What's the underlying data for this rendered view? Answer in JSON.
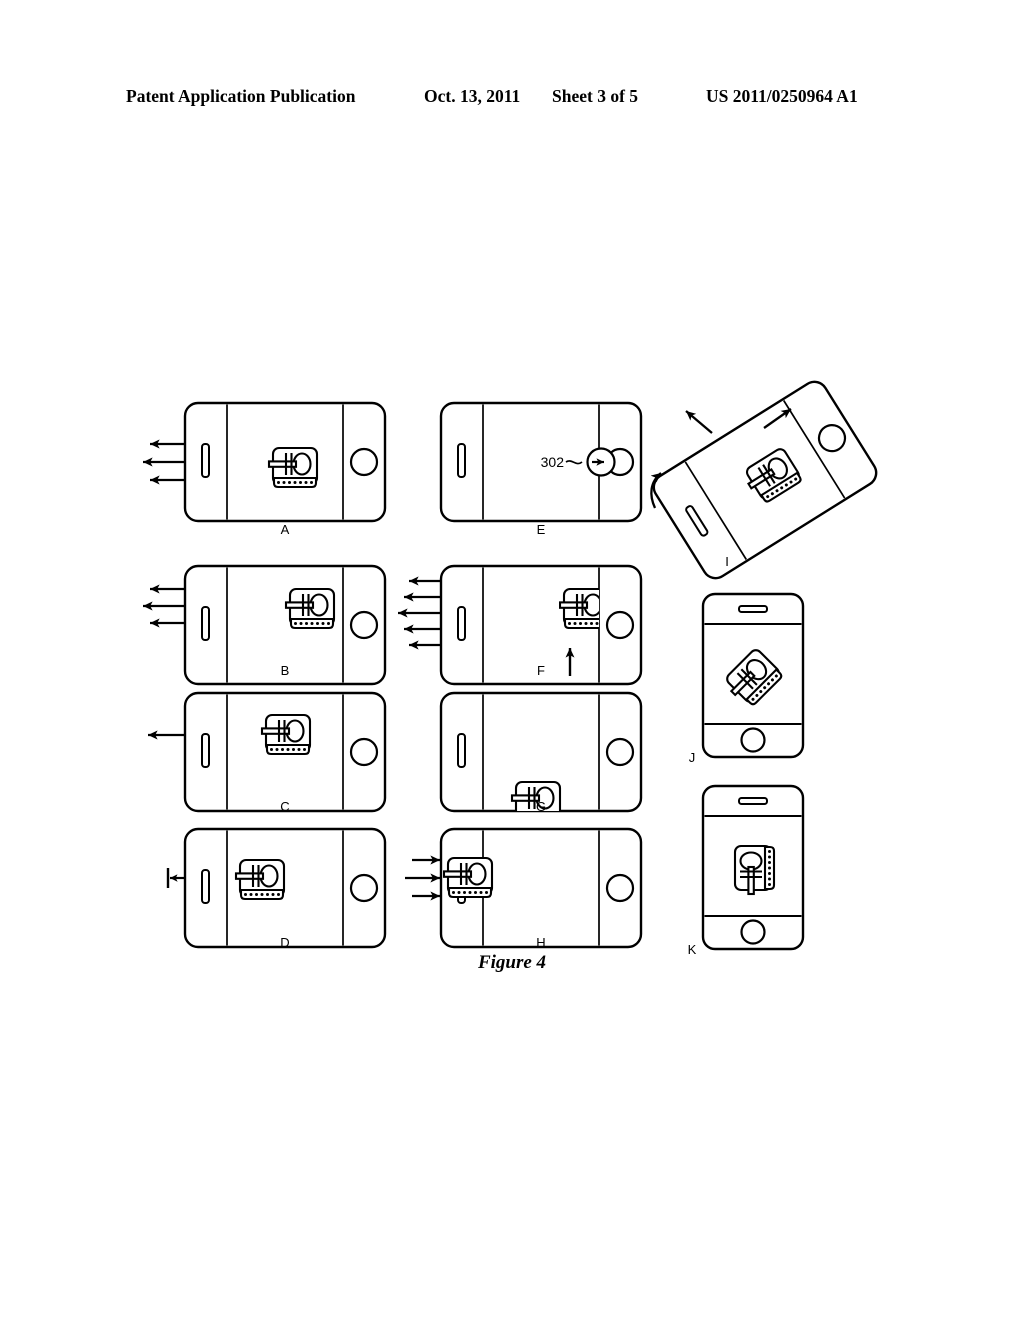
{
  "header": {
    "publication": "Patent Application Publication",
    "date": "Oct. 13, 2011",
    "sheet": "Sheet 3 of 5",
    "patent_number": "US 2011/0250964 A1"
  },
  "figure": {
    "caption": "Figure 4",
    "reference_numerals": [
      {
        "id": "302",
        "label": "302",
        "panel": "E",
        "points_to": "slide-to-unlock-arrow-circle"
      }
    ],
    "panels": [
      {
        "id": "A",
        "label": "A",
        "orientation": "landscape",
        "arrows": {
          "direction": "left",
          "count": 3,
          "style": "plain"
        },
        "icon": {
          "name": "key-icon",
          "rotation": 0,
          "position": "center-right",
          "clipped": "none"
        }
      },
      {
        "id": "B",
        "label": "B",
        "orientation": "landscape",
        "arrows": {
          "direction": "left",
          "count": 3,
          "style": "plain"
        },
        "icon": {
          "name": "key-icon",
          "rotation": 0,
          "position": "right",
          "clipped": "none"
        }
      },
      {
        "id": "C",
        "label": "C",
        "orientation": "landscape",
        "arrows": {
          "direction": "left",
          "count": 1,
          "style": "plain"
        },
        "icon": {
          "name": "key-icon",
          "rotation": 0,
          "position": "center",
          "clipped": "none"
        }
      },
      {
        "id": "D",
        "label": "D",
        "orientation": "landscape",
        "arrows": {
          "direction": "left",
          "count": 1,
          "style": "barbed"
        },
        "icon": {
          "name": "key-icon",
          "rotation": 0,
          "position": "center-left",
          "clipped": "none"
        }
      },
      {
        "id": "E",
        "label": "E",
        "orientation": "landscape",
        "arrows": {
          "direction": "none",
          "count": 0,
          "style": "none"
        },
        "icon": {
          "name": "unlock-arrow-circle-icon",
          "rotation": 0,
          "position": "right",
          "clipped": "none"
        }
      },
      {
        "id": "F",
        "label": "F",
        "orientation": "landscape",
        "arrows": {
          "direction": "left",
          "count": 5,
          "style": "plain"
        },
        "extra_arrow": {
          "direction": "up",
          "count": 1
        },
        "icon": {
          "name": "key-icon",
          "rotation": 0,
          "position": "far-right",
          "clipped": "right"
        }
      },
      {
        "id": "G",
        "label": "G",
        "orientation": "landscape",
        "arrows": {
          "direction": "none",
          "count": 0,
          "style": "none"
        },
        "icon": {
          "name": "key-icon",
          "rotation": 0,
          "position": "bottom-center",
          "clipped": "bottom"
        }
      },
      {
        "id": "H",
        "label": "H",
        "orientation": "landscape",
        "arrows": {
          "direction": "right",
          "count": 3,
          "style": "plain"
        },
        "icon": {
          "name": "key-icon",
          "rotation": 0,
          "position": "far-left",
          "clipped": "left"
        }
      },
      {
        "id": "I",
        "label": "I",
        "orientation": "tilted",
        "tilt_degrees": -30,
        "arrows": {
          "direction": "diagonal-out",
          "count": 2,
          "style": "plain"
        },
        "rotation_arrow": {
          "direction": "counter-clockwise",
          "count": 1
        },
        "icon": {
          "name": "key-icon",
          "rotation": -30,
          "position": "center",
          "clipped": "none"
        }
      },
      {
        "id": "J",
        "label": "J",
        "orientation": "portrait",
        "arrows": {
          "direction": "none",
          "count": 0,
          "style": "none"
        },
        "icon": {
          "name": "key-icon",
          "rotation": -45,
          "position": "center",
          "clipped": "none"
        }
      },
      {
        "id": "K",
        "label": "K",
        "orientation": "portrait",
        "arrows": {
          "direction": "none",
          "count": 0,
          "style": "none"
        },
        "icon": {
          "name": "key-icon",
          "rotation": -90,
          "position": "center",
          "clipped": "none"
        }
      }
    ],
    "colors": {
      "ink": "#000000",
      "paper": "#ffffff"
    }
  }
}
